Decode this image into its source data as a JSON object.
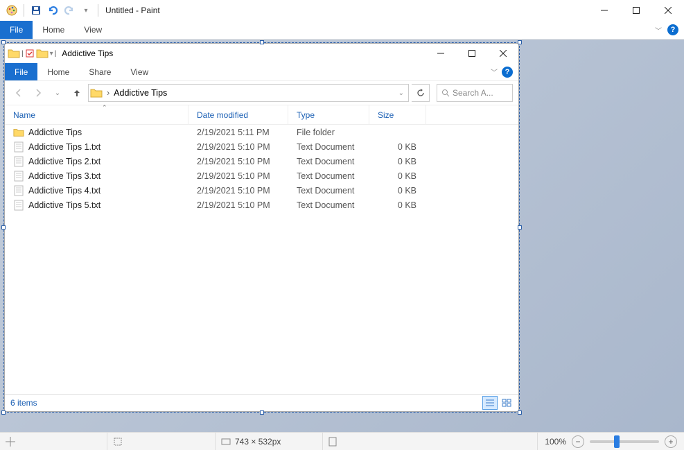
{
  "paint": {
    "title": "Untitled - Paint",
    "tabs": {
      "file": "File",
      "home": "Home",
      "view": "View"
    },
    "status": {
      "cursor_icon": "cursor-pos-icon",
      "selection_icon": "selection-size-icon",
      "canvas_size_label": "743 × 532px",
      "zoom_label": "100%"
    }
  },
  "explorer": {
    "title": "Addictive Tips",
    "tabs": {
      "file": "File",
      "home": "Home",
      "share": "Share",
      "view": "View"
    },
    "breadcrumb": "Addictive Tips",
    "search_placeholder": "Search A...",
    "columns": {
      "name": "Name",
      "date": "Date modified",
      "type": "Type",
      "size": "Size"
    },
    "items": [
      {
        "icon": "folder",
        "name": "Addictive Tips",
        "date": "2/19/2021 5:11 PM",
        "type": "File folder",
        "size": ""
      },
      {
        "icon": "txt",
        "name": "Addictive Tips 1.txt",
        "date": "2/19/2021 5:10 PM",
        "type": "Text Document",
        "size": "0 KB"
      },
      {
        "icon": "txt",
        "name": "Addictive Tips 2.txt",
        "date": "2/19/2021 5:10 PM",
        "type": "Text Document",
        "size": "0 KB"
      },
      {
        "icon": "txt",
        "name": "Addictive Tips 3.txt",
        "date": "2/19/2021 5:10 PM",
        "type": "Text Document",
        "size": "0 KB"
      },
      {
        "icon": "txt",
        "name": "Addictive Tips 4.txt",
        "date": "2/19/2021 5:10 PM",
        "type": "Text Document",
        "size": "0 KB"
      },
      {
        "icon": "txt",
        "name": "Addictive Tips 5.txt",
        "date": "2/19/2021 5:10 PM",
        "type": "Text Document",
        "size": "0 KB"
      }
    ],
    "status": "6 items"
  }
}
